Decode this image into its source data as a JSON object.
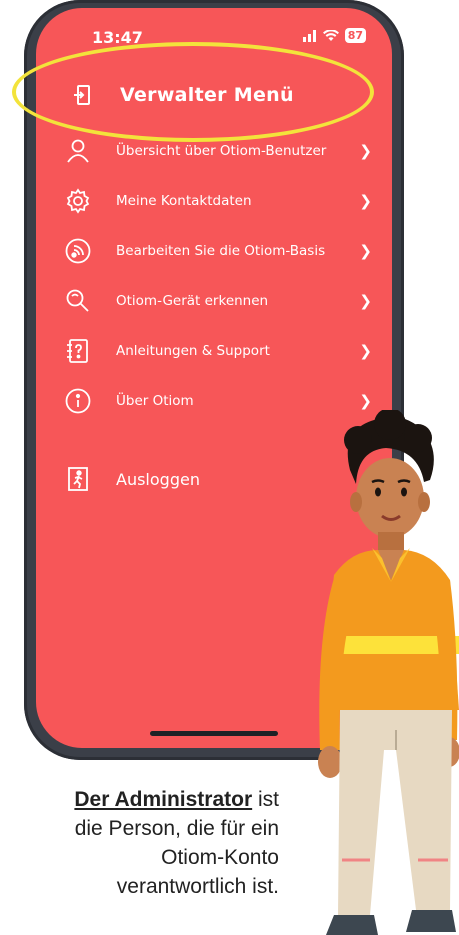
{
  "status_bar": {
    "time": "13:47",
    "battery": "87"
  },
  "header": {
    "title": "Verwalter Menü"
  },
  "menu": {
    "items": [
      {
        "label": "Übersicht über Otiom-Benutzer",
        "icon": "user-icon"
      },
      {
        "label": "Meine Kontaktdaten",
        "icon": "gear-icon"
      },
      {
        "label": "Bearbeiten Sie die Otiom-Basis",
        "icon": "signal-icon"
      },
      {
        "label": "Otiom-Gerät erkennen",
        "icon": "search-device-icon"
      },
      {
        "label": "Anleitungen & Support",
        "icon": "help-book-icon"
      },
      {
        "label": "Über Otiom",
        "icon": "info-icon"
      }
    ],
    "logout": {
      "label": "Ausloggen",
      "icon": "logout-icon"
    }
  },
  "caption": {
    "strong": "Der Administrator",
    "rest_1": " ist",
    "line_2": "die Person, die für ein",
    "line_3": "Otiom-Konto",
    "line_4": "verantwortlich ist."
  },
  "colors": {
    "screen": "#f75658",
    "highlight": "#f3e33b",
    "frame": "#3b3f48"
  }
}
